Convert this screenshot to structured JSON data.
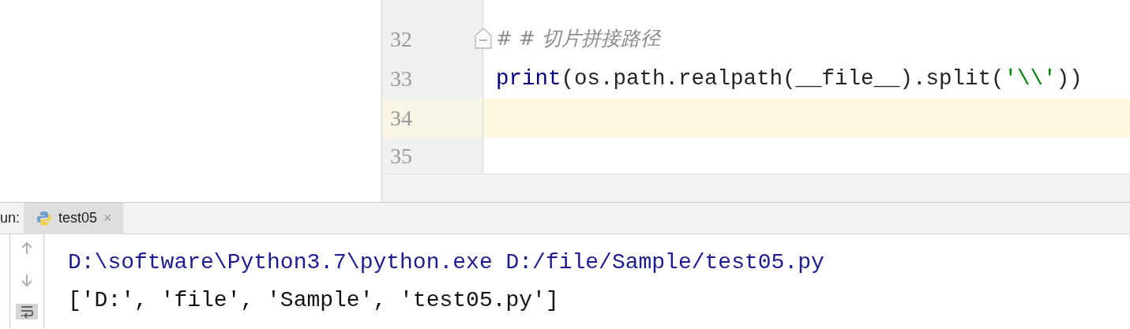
{
  "editor": {
    "lines": [
      {
        "number": "32",
        "current": false,
        "fold": true,
        "tokens": [
          {
            "kind": "comment",
            "text": "# # 切片拼接路径"
          }
        ]
      },
      {
        "number": "33",
        "current": false,
        "fold": false,
        "tokens": [
          {
            "kind": "builtin",
            "text": "print"
          },
          {
            "kind": "plain",
            "text": "(os.path.realpath(__file__).split("
          },
          {
            "kind": "string",
            "text": "'\\\\'"
          },
          {
            "kind": "plain",
            "text": "))"
          }
        ]
      },
      {
        "number": "34",
        "current": true,
        "fold": false
      },
      {
        "number": "35",
        "current": false,
        "fold": false
      }
    ]
  },
  "run_panel": {
    "label": "un:",
    "tabs": [
      {
        "label": "test05",
        "close": "×",
        "selected": true
      }
    ],
    "toolbar": [
      {
        "kind": "up",
        "on": false
      },
      {
        "kind": "down",
        "on": false
      },
      {
        "kind": "wrap",
        "on": true
      }
    ],
    "output": [
      {
        "kind": "command",
        "text": "D:\\software\\Python3.7\\python.exe D:/file/Sample/test05.py"
      },
      {
        "kind": "stdout",
        "text": "['D:', 'file', 'Sample', 'test05.py']"
      }
    ]
  }
}
